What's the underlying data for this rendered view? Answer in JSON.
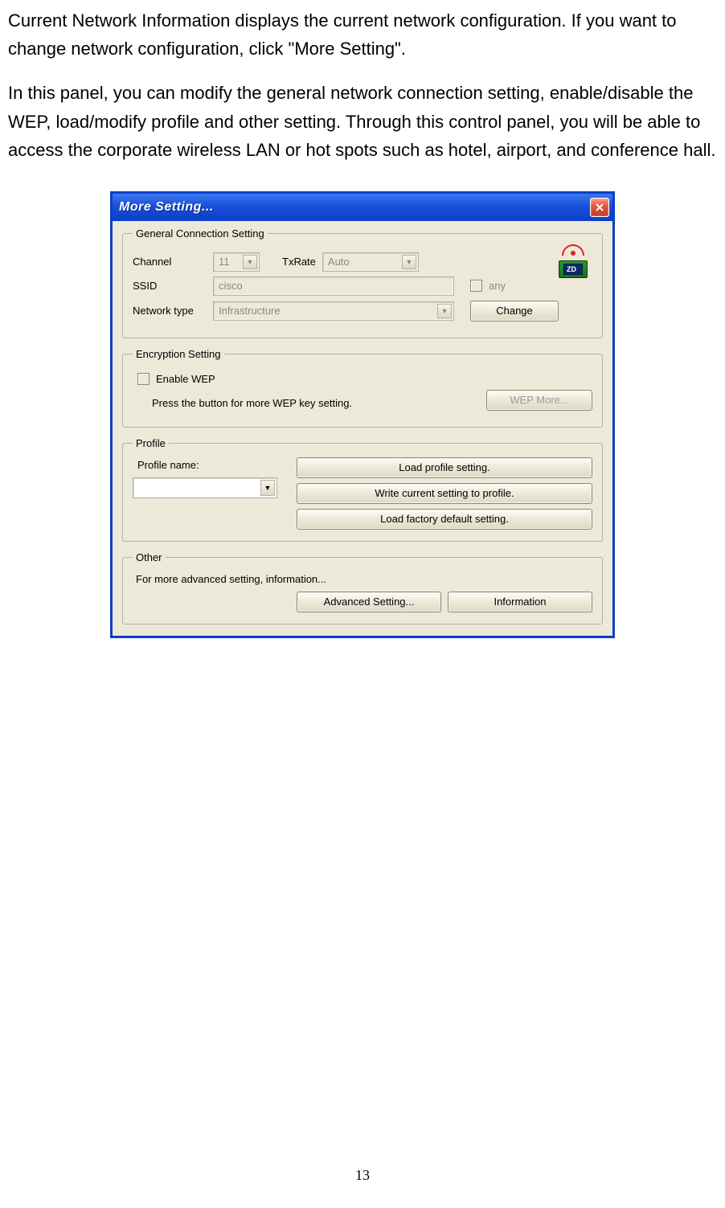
{
  "doc": {
    "para1": "Current Network Information displays the current network configuration. If you want to change network configuration, click \"More Setting\".",
    "para2": "In this panel, you can modify the general network connection setting, enable/disable the WEP, load/modify profile and other setting. Through this control panel, you will be able to access the corporate wireless LAN or hot spots such as hotel, airport, and conference hall.",
    "page_number": "13"
  },
  "dialog": {
    "title": "More Setting...",
    "general": {
      "legend": "General Connection Setting",
      "channel_label": "Channel",
      "channel_value": "11",
      "txrate_label": "TxRate",
      "txrate_value": "Auto",
      "ssid_label": "SSID",
      "ssid_value": "cisco",
      "any_label": "any",
      "nettype_label": "Network type",
      "nettype_value": "Infrastructure",
      "change_btn": "Change",
      "icon_zd": "ZD"
    },
    "encryption": {
      "legend": "Encryption Setting",
      "enable_wep": "Enable WEP",
      "hint": "Press the button for more WEP key setting.",
      "wep_more_btn": "WEP More..."
    },
    "profile": {
      "legend": "Profile",
      "name_label": "Profile name:",
      "load_btn": "Load profile setting.",
      "write_btn": "Write current setting to profile.",
      "factory_btn": "Load factory default setting."
    },
    "other": {
      "legend": "Other",
      "hint": "For more advanced setting, information...",
      "advanced_btn": "Advanced Setting...",
      "info_btn": "Information"
    }
  }
}
